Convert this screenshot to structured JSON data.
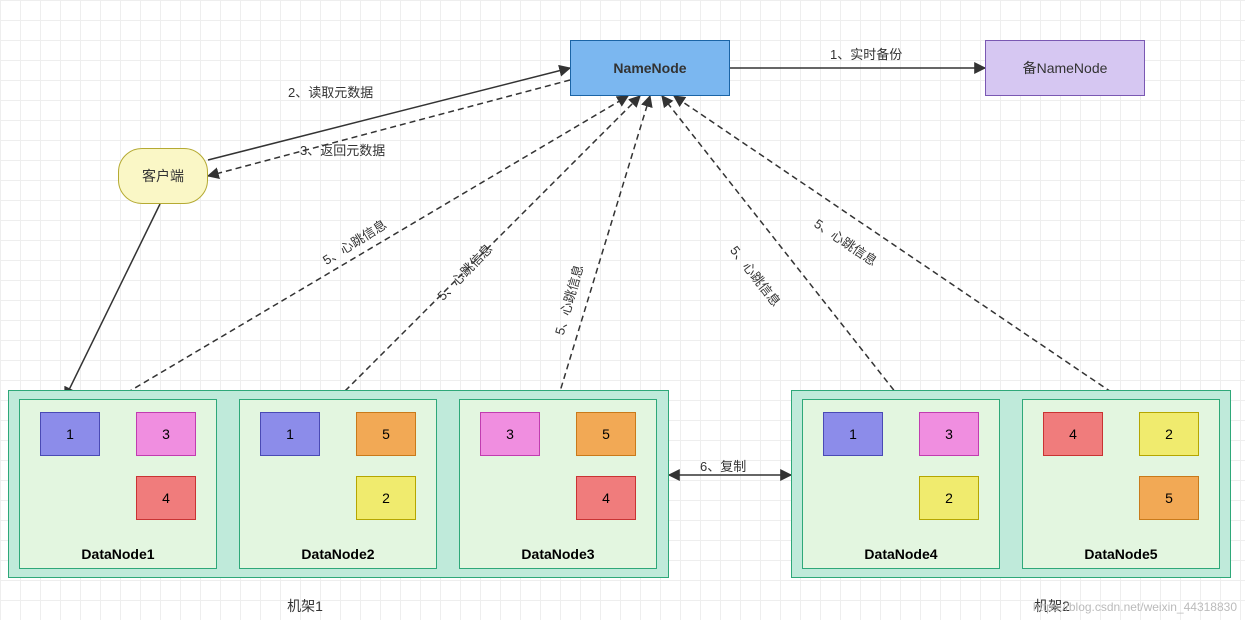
{
  "nodes": {
    "namenode": "NameNode",
    "backup_namenode": "备NameNode",
    "client": "客户端"
  },
  "edges": {
    "e1": "1、实时备份",
    "e2": "2、读取元数据",
    "e3": "3、返回元数据",
    "e6": "6、复制",
    "hb1": "5、心跳信息",
    "hb2": "5、心跳信息",
    "hb3": "5、心跳信息",
    "hb4": "5、心跳信息",
    "hb5": "5、心跳信息"
  },
  "racks": {
    "rack1_label": "机架1",
    "rack2_label": "机架2"
  },
  "datanodes": [
    {
      "name": "DataNode1",
      "rack": 1,
      "blocks": [
        {
          "id": "1",
          "color": "c1",
          "pos": "tl"
        },
        {
          "id": "3",
          "color": "c3",
          "pos": "tr"
        },
        {
          "id": "4",
          "color": "c4",
          "pos": "br"
        }
      ]
    },
    {
      "name": "DataNode2",
      "rack": 1,
      "blocks": [
        {
          "id": "1",
          "color": "c1",
          "pos": "tl"
        },
        {
          "id": "5",
          "color": "c5",
          "pos": "tr"
        },
        {
          "id": "2",
          "color": "c2",
          "pos": "br"
        }
      ]
    },
    {
      "name": "DataNode3",
      "rack": 1,
      "blocks": [
        {
          "id": "3",
          "color": "c3",
          "pos": "tl"
        },
        {
          "id": "5",
          "color": "c5",
          "pos": "tr"
        },
        {
          "id": "4",
          "color": "c4",
          "pos": "br"
        }
      ]
    },
    {
      "name": "DataNode4",
      "rack": 2,
      "blocks": [
        {
          "id": "1",
          "color": "c1",
          "pos": "tl"
        },
        {
          "id": "3",
          "color": "c3",
          "pos": "tr"
        },
        {
          "id": "2",
          "color": "c2",
          "pos": "br"
        }
      ]
    },
    {
      "name": "DataNode5",
      "rack": 2,
      "blocks": [
        {
          "id": "4",
          "color": "c4",
          "pos": "tl"
        },
        {
          "id": "2",
          "color": "c2",
          "pos": "tr"
        },
        {
          "id": "5",
          "color": "c5",
          "pos": "br"
        }
      ]
    }
  ],
  "watermark": "https://blog.csdn.net/weixin_44318830"
}
